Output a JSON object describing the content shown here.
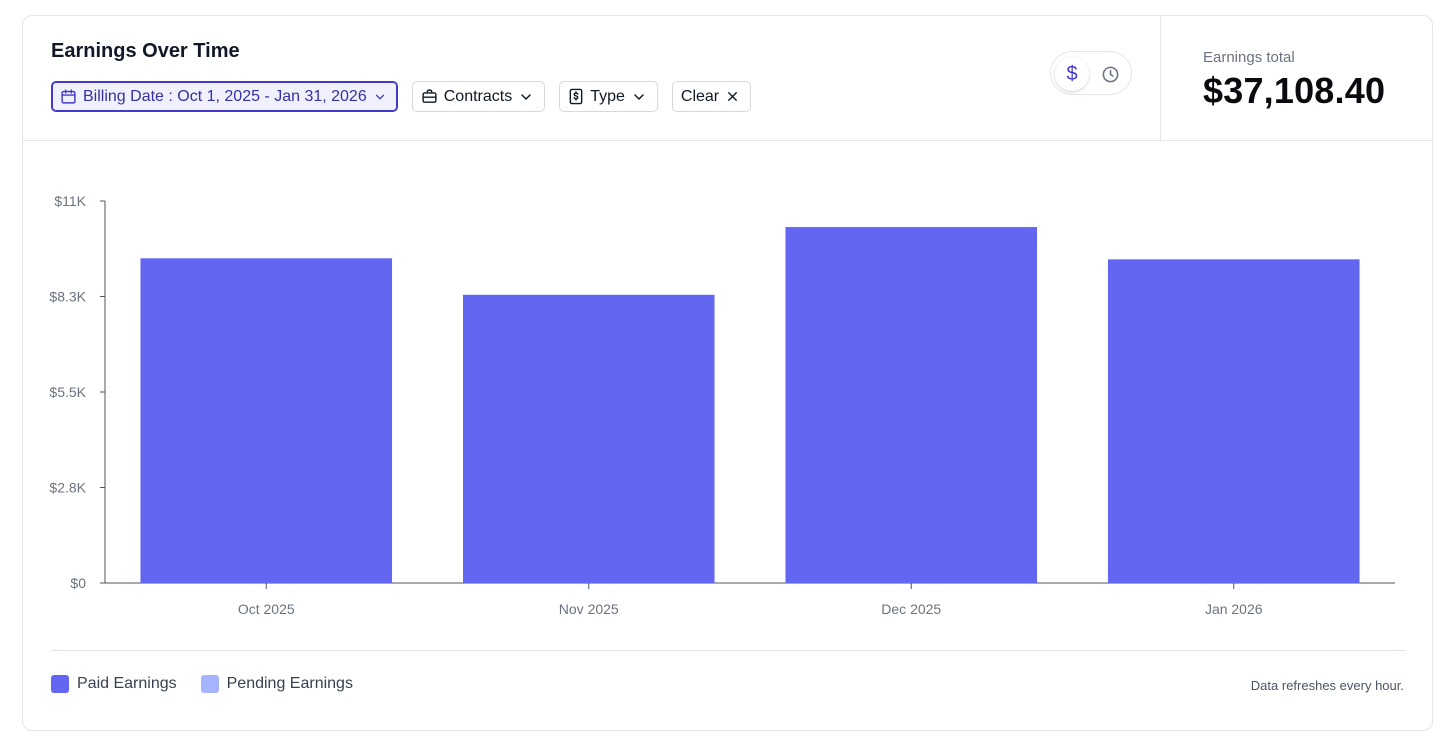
{
  "header": {
    "title": "Earnings Over Time",
    "filters": {
      "billing_date": "Billing Date : Oct 1, 2025 - Jan 31, 2026",
      "contracts": "Contracts",
      "type": "Type",
      "clear": "Clear"
    },
    "toggle": {
      "dollar_glyph": "$",
      "selected": "dollar"
    }
  },
  "summary": {
    "label": "Earnings total",
    "value": "$37,108.40"
  },
  "legend": {
    "paid": {
      "label": "Paid Earnings",
      "color": "#6366f1"
    },
    "pending": {
      "label": "Pending Earnings",
      "color": "#a5b4fc"
    }
  },
  "footer_note": "Data refreshes every hour.",
  "colors": {
    "accent": "#4338ca",
    "bar": "#6366f1"
  },
  "chart_data": {
    "type": "bar",
    "categories": [
      "Oct 2025",
      "Nov 2025",
      "Dec 2025",
      "Jan 2026"
    ],
    "series": [
      {
        "name": "Paid Earnings",
        "values": [
          9350,
          8300,
          10250,
          9320
        ],
        "color": "#6366f1"
      },
      {
        "name": "Pending Earnings",
        "values": [
          0,
          0,
          0,
          0
        ],
        "color": "#a5b4fc"
      }
    ],
    "yticks": [
      {
        "value": 0,
        "label": "$0"
      },
      {
        "value": 2750,
        "label": "$2.8K"
      },
      {
        "value": 5500,
        "label": "$5.5K"
      },
      {
        "value": 8250,
        "label": "$8.3K"
      },
      {
        "value": 11000,
        "label": "$11K"
      }
    ],
    "ylim": [
      0,
      11000
    ],
    "grid": false,
    "legend_position": "bottom-left"
  }
}
